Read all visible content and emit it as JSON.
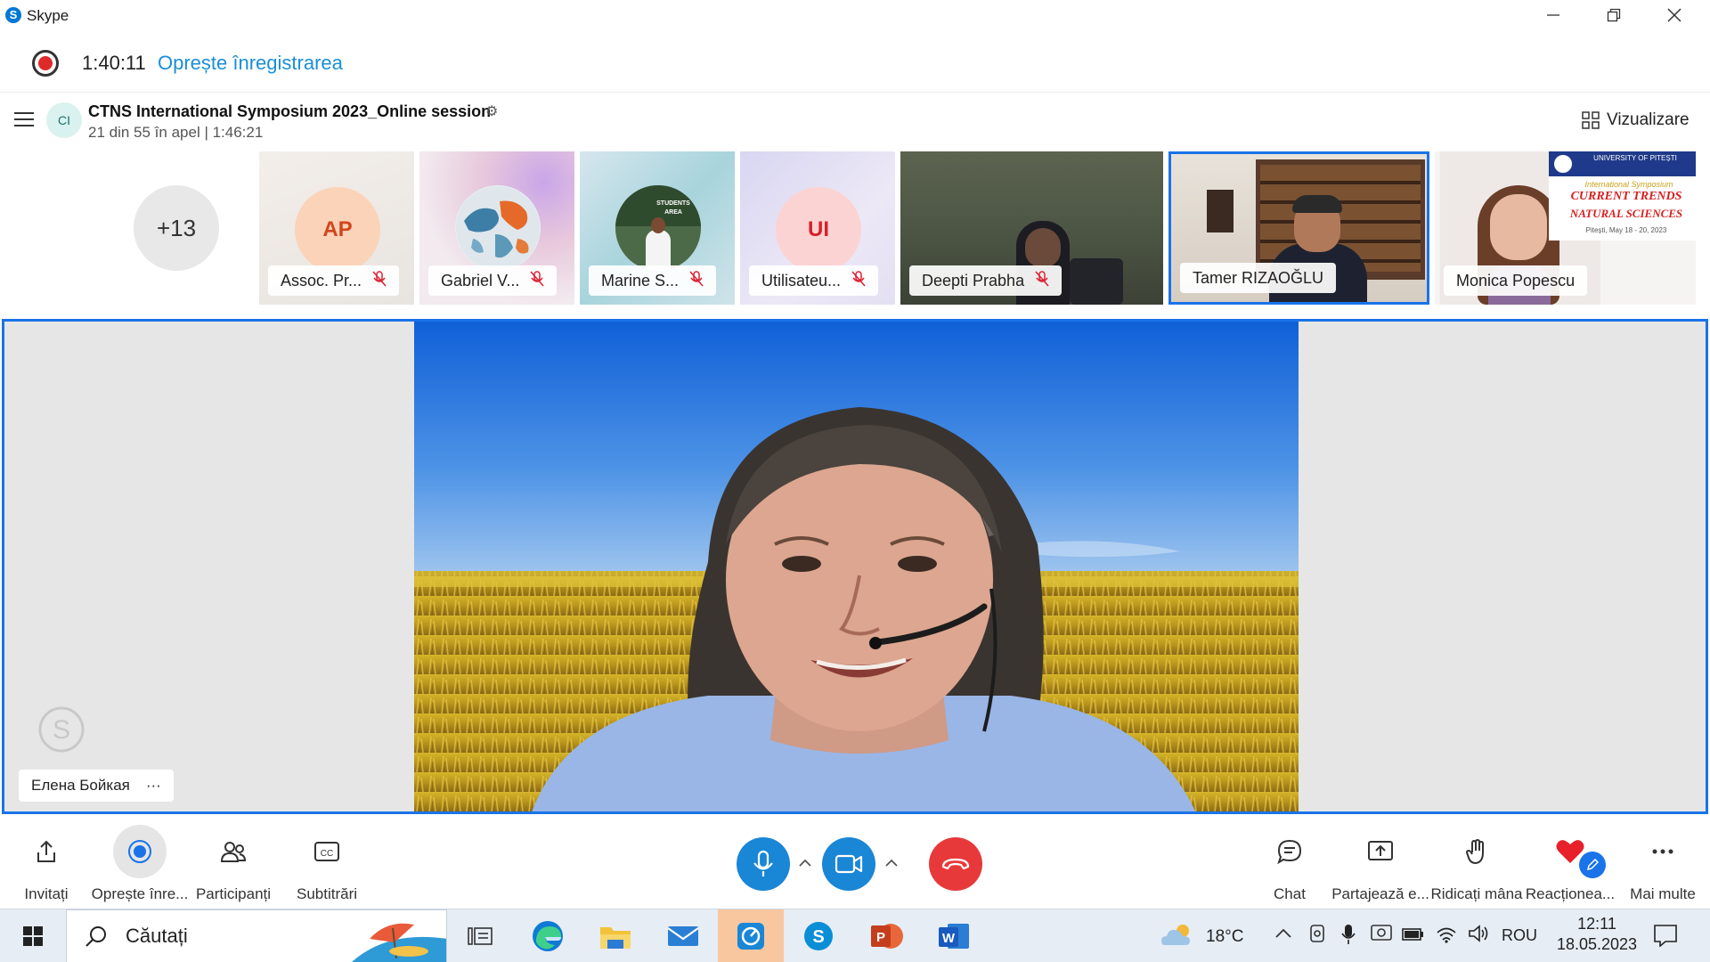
{
  "window": {
    "app_name": "Skype",
    "app_logo": "S"
  },
  "recording": {
    "elapsed": "1:40:11",
    "stop_label": "Oprește înregistrarea"
  },
  "conversation": {
    "avatar_initials": "CI",
    "title": "CTNS International Symposium 2023_Online session",
    "subtitle": "21 din 55 în apel | 1:46:21",
    "view_label": "Vizualizare"
  },
  "participants": {
    "more_count": "+13",
    "tiles": [
      {
        "name": "Assoc. Pr...",
        "initials": "AP",
        "muted": true
      },
      {
        "name": "Gabriel V...",
        "muted": true
      },
      {
        "name": "Marine S...",
        "muted": true
      },
      {
        "name": "Utilisateu...",
        "initials": "UI",
        "muted": true
      },
      {
        "name": "Deepti Prabha",
        "muted": true
      },
      {
        "name": "Tamer RIZAOĞLU",
        "muted": false,
        "active": true
      },
      {
        "name": "Monica Popescu",
        "muted": false
      }
    ],
    "monica_banner": {
      "line1": "UNIVERSITY OF PITEȘTI",
      "line2": "International Symposium",
      "line3": "CURRENT TRENDS",
      "line4": "NATURAL SCIENCES",
      "line5": "Pitești, May 18 - 20, 2023"
    },
    "marine_sign": "STUDENTS AREA"
  },
  "stage": {
    "speaker_name": "Елена Бойкая",
    "speaker_more": "···"
  },
  "controls": {
    "invite": "Invitați",
    "stop_rec": "Oprește înre...",
    "participants": "Participanți",
    "subtitles": "Subtitrări",
    "chat": "Chat",
    "share": "Partajează e...",
    "raise_hand": "Ridicați mâna",
    "react": "Reacționea...",
    "more": "Mai multe"
  },
  "taskbar": {
    "search_placeholder": "Căutați",
    "weather": "18°C",
    "language": "ROU",
    "time": "12:11",
    "date": "18.05.2023"
  },
  "colors": {
    "accent": "#1a73e8",
    "call_blue": "#1a86d6",
    "hangup": "#e8393a",
    "record_red": "#e02a2a",
    "link": "#1a8fd6"
  }
}
